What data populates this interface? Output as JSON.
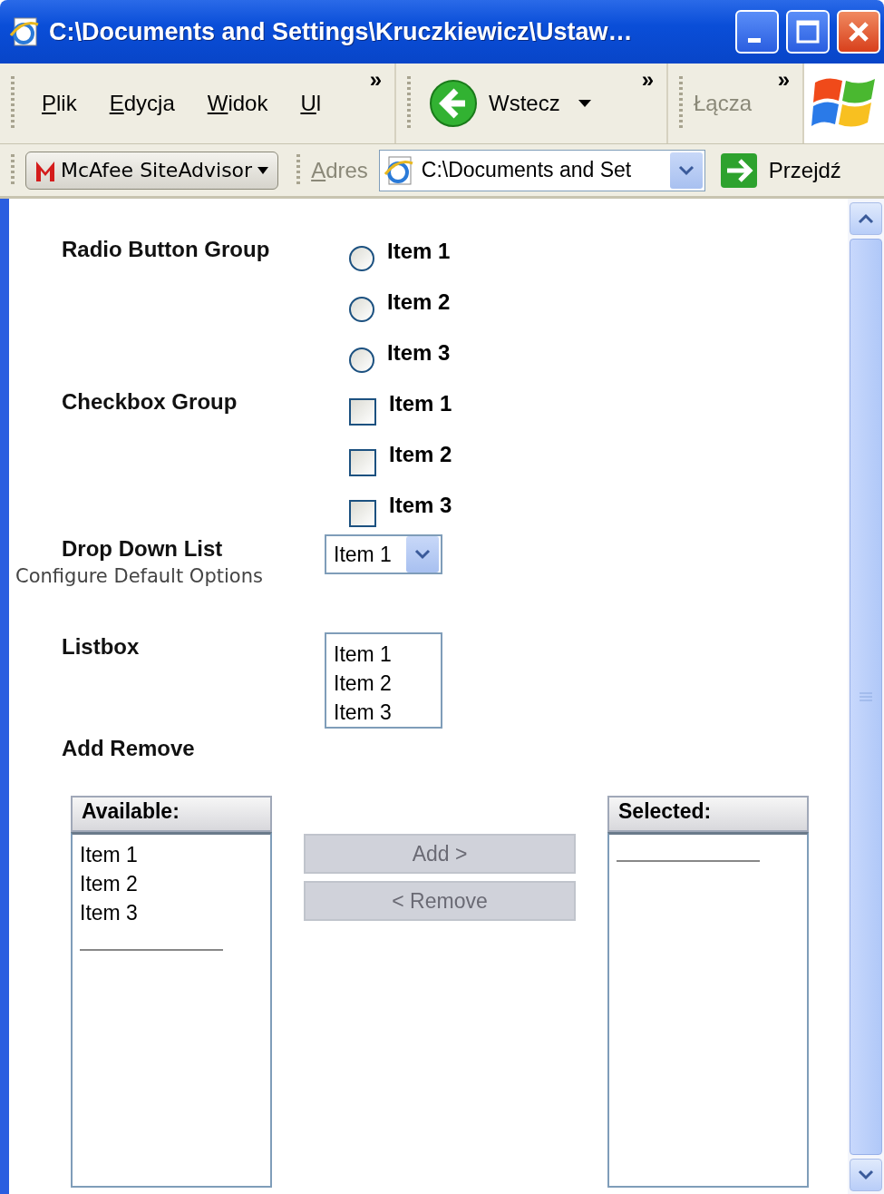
{
  "window": {
    "title": "C:\\Documents and Settings\\Kruczkiewicz\\Ustaw…"
  },
  "menu_bar": {
    "items": [
      "Plik",
      "Edycja",
      "Widok",
      "Ul"
    ],
    "chevron": "»"
  },
  "nav_bar": {
    "back": "Wstecz",
    "chevron": "»"
  },
  "links_bar": {
    "label": "Łącza",
    "chevron": "»"
  },
  "address_bar": {
    "mcafee": "McAfee SiteAdvisor",
    "label": "Adres",
    "value": "C:\\Documents and Set",
    "go": "Przejdź"
  },
  "form": {
    "radio_group": {
      "label": "Radio Button Group",
      "items": [
        {
          "label": "Item 1",
          "selected": false
        },
        {
          "label": "Item 2",
          "selected": false
        },
        {
          "label": "Item 3",
          "selected": false
        }
      ]
    },
    "checkbox_group": {
      "label": "Checkbox Group",
      "items": [
        {
          "label": "Item 1",
          "checked": false
        },
        {
          "label": "Item 2",
          "checked": false
        },
        {
          "label": "Item 3",
          "checked": false
        }
      ]
    },
    "drop_down": {
      "label": "Drop Down List",
      "value": "Item 1"
    },
    "listbox": {
      "label": "Listbox",
      "items": [
        "Item 1",
        "Item 2",
        "Item 3"
      ]
    },
    "add_remove": {
      "label": "Add Remove",
      "available": {
        "header": "Available:",
        "items": [
          "Item 1",
          "Item 2",
          "Item 3"
        ]
      },
      "buttons": [
        {
          "label": "Add >",
          "disabled": true
        },
        {
          "label": "< Remove",
          "disabled": true
        }
      ],
      "selected": {
        "header": "Selected:"
      }
    }
  },
  "overlay_text": "Configure Default Options"
}
